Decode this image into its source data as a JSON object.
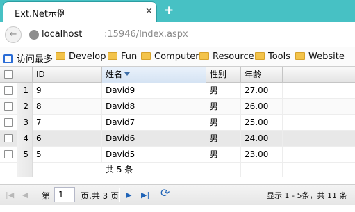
{
  "browser": {
    "tab_title": "Ext.Net示例",
    "tab_close": "✕",
    "new_tab": "+",
    "url_host": "localhost",
    "url_rest": ":15946/Index.aspx",
    "back": "←"
  },
  "bookmarks": [
    "访问最多",
    "Develop",
    "Fun",
    "Computer",
    "Resource",
    "Tools",
    "Website"
  ],
  "grid": {
    "headers": {
      "id": "ID",
      "name": "姓名",
      "gender": "性别",
      "age": "年龄"
    },
    "rows": [
      {
        "num": "1",
        "id": "9",
        "name": "David9",
        "gender": "男",
        "age": "27.00"
      },
      {
        "num": "2",
        "id": "8",
        "name": "David8",
        "gender": "男",
        "age": "26.00"
      },
      {
        "num": "3",
        "id": "7",
        "name": "David7",
        "gender": "男",
        "age": "25.00"
      },
      {
        "num": "4",
        "id": "6",
        "name": "David6",
        "gender": "男",
        "age": "24.00"
      },
      {
        "num": "5",
        "id": "5",
        "name": "David5",
        "gender": "男",
        "age": "23.00"
      }
    ],
    "summary": "共 5 条"
  },
  "pager": {
    "first": "|◀",
    "prev": "◀",
    "page_label": "第",
    "page_value": "1",
    "page_total": "页,共 3 页",
    "next": "▶",
    "last": "▶|",
    "refresh": "⟳",
    "display_info": "显示 1 - 5条，共 11 条"
  },
  "colors": {
    "titlebar": "#47c1c4",
    "accent": "#1f63b7"
  }
}
